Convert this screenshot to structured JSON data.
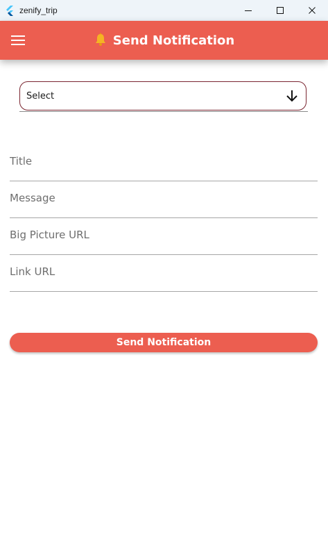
{
  "window": {
    "title": "zenify_trip"
  },
  "appbar": {
    "title": "Send Notification",
    "menu_icon": "hamburger-menu-icon",
    "title_icon": "bell-icon"
  },
  "form": {
    "dropdown_value": "Select",
    "fields": [
      {
        "placeholder": "Title",
        "value": ""
      },
      {
        "placeholder": "Message",
        "value": ""
      },
      {
        "placeholder": "Big Picture URL",
        "value": ""
      },
      {
        "placeholder": "Link URL",
        "value": ""
      }
    ],
    "submit_label": "Send Notification"
  },
  "colors": {
    "accent": "#ec5e50",
    "dropdown_border": "#7a2530",
    "bell": "#f5b324"
  }
}
